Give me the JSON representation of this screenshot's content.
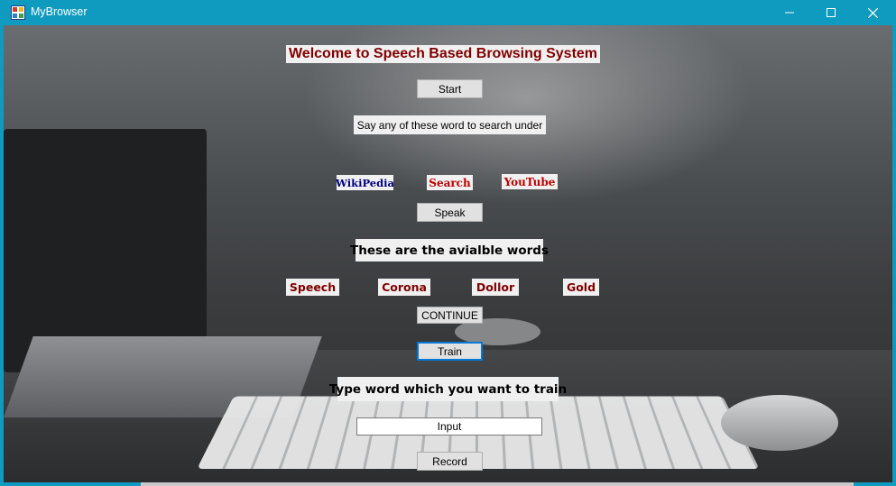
{
  "window": {
    "title": "MyBrowser",
    "controls": {
      "minimize": "minimize",
      "maximize": "maximize",
      "close": "close"
    }
  },
  "main": {
    "heading": "Welcome to Speech Based Browsing System",
    "start_button": "Start",
    "say_label": "Say any of these word to search under",
    "search_options": [
      "WikiPedia",
      "Search",
      "YouTube"
    ],
    "speak_button": "Speak",
    "available_label": "These are the avialble words",
    "words": [
      "Speech",
      "Corona",
      "Dollor",
      "Gold"
    ],
    "continue_button": "CONTINUE",
    "train_button": "Train",
    "train_label": "Type word which you want to train",
    "input_value": "Input",
    "record_button": "Record"
  },
  "colors": {
    "titlebar": "#0f9bbf",
    "heading_text": "#800000",
    "wikipedia_text": "#000080",
    "search_text": "#c00000",
    "word_text": "#800000",
    "focus_border": "#0078d7"
  },
  "icons": {
    "app": "app-window-icon"
  }
}
